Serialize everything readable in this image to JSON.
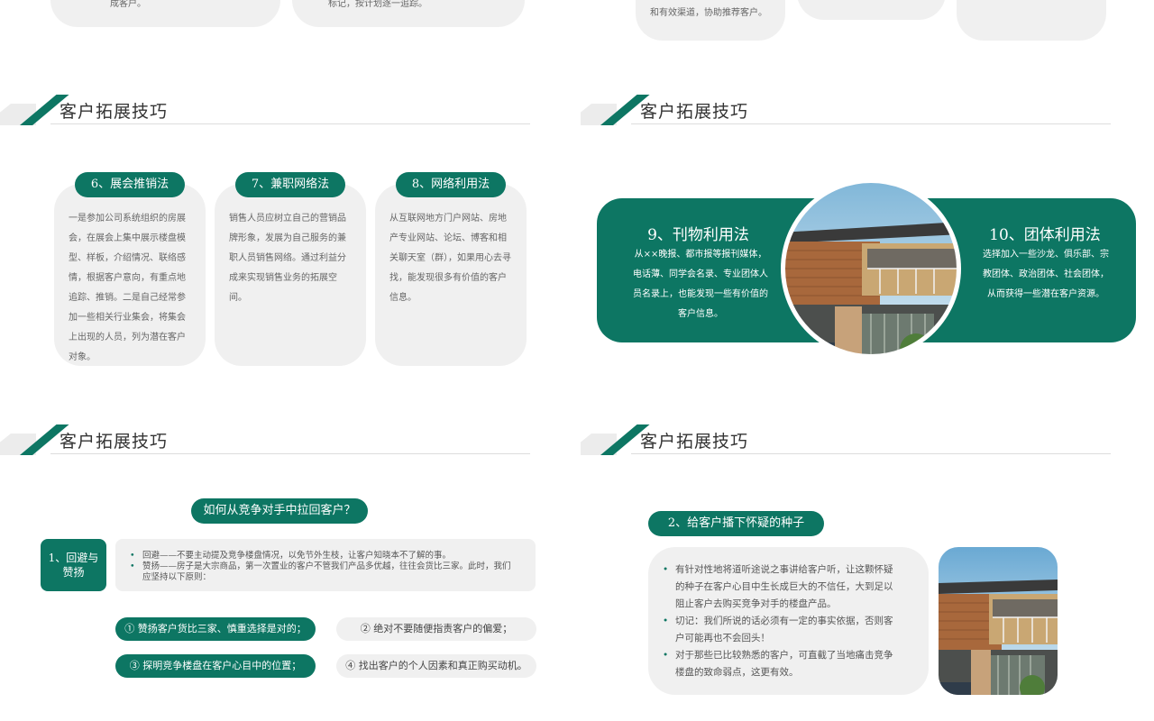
{
  "top": {
    "left_card_1_text": "成客户。",
    "left_card_2_text": "标记，按计划逐一追踪。",
    "right_card_1_text": "和有效渠道，协助推荐客户。"
  },
  "sections": {
    "header_title": "客户拓展技巧"
  },
  "panel1": {
    "cards": [
      {
        "label": "6、展会推销法",
        "body": "一是参加公司系统组织的房展会，在展会上集中展示楼盘模型、样板，介绍情况、联络感情，根据客户意向，有重点地追踪、推销。二是自己经常参加一些相关行业集会，将集会上出现的人员，列为潜在客户对象。"
      },
      {
        "label": "7、兼职网络法",
        "body": "销售人员应树立自己的营销品牌形象，发展为自己服务的兼职人员销售网络。通过利益分成来实现销售业务的拓展空间。"
      },
      {
        "label": "8、网络利用法",
        "body": "从互联网地方门户网站、房地产专业网站、论坛、博客和相关聊天室（群），如果用心去寻找，能发现很多有价值的客户信息。"
      }
    ]
  },
  "panel2": {
    "left_title": "9、刊物利用法",
    "left_body": "从××晚报、都市报等报刊媒体，电话薄、同学会名录、专业团体人员名录上，也能发现一些有价值的客户信息。",
    "right_title": "10、团体利用法",
    "right_body": "选择加入一些沙龙、俱乐部、宗教团体、政治团体、社会团体，从而获得一些潜在客户资源。"
  },
  "panel3": {
    "question": "如何从竞争对手中拉回客户？",
    "tag": "1、回避与赞扬",
    "bullets": [
      "回避——不要主动提及竞争楼盘情况，以免节外生枝，让客户知晓本不了解的事。",
      "赞扬——房子是大宗商品，第一次置业的客户不管我们产品多优越，往往会货比三家。此时，我们应坚持以下原则："
    ],
    "options": [
      "① 赞扬客户货比三家、慎重选择是对的；",
      "② 绝对不要随便指责客户的偏爱；",
      "③ 探明竞争楼盘在客户心目中的位置；",
      "④ 找出客户的个人因素和真正购买动机。"
    ]
  },
  "panel4": {
    "tag": "2、给客户播下怀疑的种子",
    "bullets": [
      "有针对性地将道听途说之事讲给客户听，让这颗怀疑的种子在客户心目中生长成巨大的不信任，大到足以阻止客户去购买竞争对手的楼盘产品。",
      "切记：我们所说的话必须有一定的事实依据，否则客户可能再也不会回头！",
      "对于那些已比较熟悉的客户，可直截了当地痛击竞争楼盘的致命弱点，这更有效。"
    ]
  },
  "colors": {
    "accent": "#0d7663",
    "card": "#f0f0f0"
  }
}
